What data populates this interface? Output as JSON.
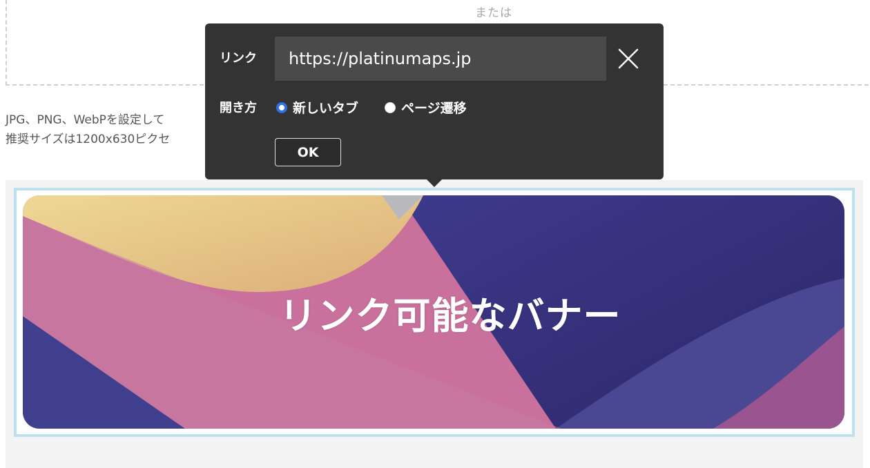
{
  "dropzone": {
    "or_text": "または"
  },
  "help": {
    "line1": "JPG、PNG、WebPを設定して",
    "line2": "推奨サイズは1200x630ピクセ"
  },
  "banner": {
    "text": "リンク可能なバナー",
    "colors": {
      "purple": "#3f3a8a",
      "pink": "#c9709b",
      "yellow": "#e6c07f"
    }
  },
  "popover": {
    "link_label": "リンク",
    "url_value": "https://platinumaps.jp",
    "close_icon": "close-icon",
    "open_label": "開き方",
    "options": [
      {
        "label": "新しいタブ",
        "selected": true
      },
      {
        "label": "ページ遷移",
        "selected": false
      }
    ],
    "ok_label": "OK"
  }
}
